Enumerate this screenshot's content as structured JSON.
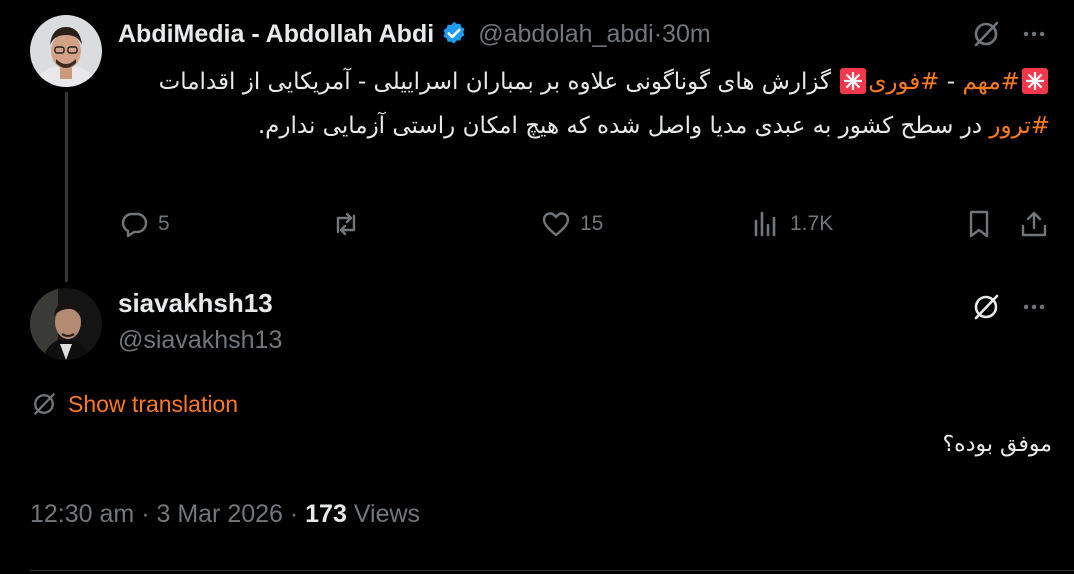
{
  "tweet": {
    "author_name": "AbdiMedia - Abdollah Abdi",
    "handle": "@abdolah_abdi",
    "separator": " · ",
    "time_ago": "30m",
    "text": {
      "hashtag_1": "#مهم",
      "dash_1": " - ",
      "hashtag_2": "#فوری",
      "part_1": " گزارش های گوناگونی علاوه بر بمباران اسراییلی - آمریکایی از اقدامات ",
      "hashtag_3": "#ترور",
      "part_2": " در سطح کشور به عبدی مدیا واصل شده که هیچ امکان راستی آزمایی ندارم."
    },
    "actions": {
      "replies": "5",
      "reposts": "",
      "likes": "15",
      "views": "1.7K"
    }
  },
  "reply": {
    "author_name": "siavakhsh13",
    "handle": "@siavakhsh13",
    "show_translation": "Show translation",
    "text": "موفق بوده؟",
    "time": "12:30 am",
    "separator": " · ",
    "date": "3 Mar 2026",
    "separator_2": " · ",
    "views_count": "173",
    "views_label": " Views"
  },
  "colors": {
    "background": "#000000",
    "text": "#e7e9ea",
    "muted": "#71767b",
    "accent": "#ff7a1a",
    "verified": "#1d9bf0"
  },
  "icons": [
    "verified-badge-icon",
    "grok-icon",
    "more-icon",
    "reply-icon",
    "repost-icon",
    "like-icon",
    "views-icon",
    "bookmark-icon",
    "share-icon",
    "translate-icon",
    "siren-icon"
  ]
}
